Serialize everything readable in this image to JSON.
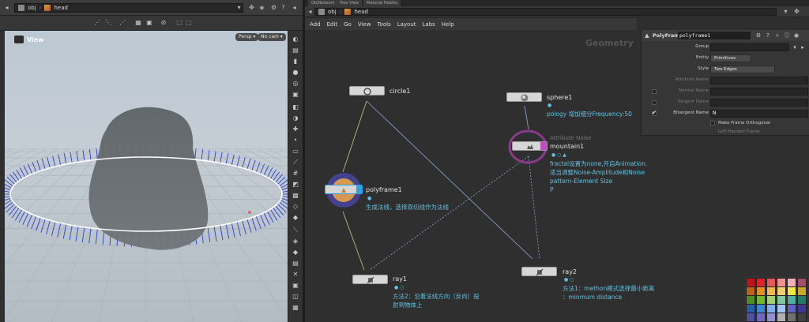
{
  "left": {
    "path": {
      "obj": "obj",
      "head": "head"
    },
    "viewport": {
      "view_label": "View",
      "persp_btn": "Persp ▾",
      "cam_btn": "No cam ▾"
    }
  },
  "right": {
    "tabs": [
      "ObjNetwork",
      "Tree View",
      "Material Palette"
    ],
    "path": {
      "obj": "obj",
      "head": "head"
    },
    "menus": [
      "Add",
      "Edit",
      "Go",
      "View",
      "Tools",
      "Layout",
      "Labs",
      "Help"
    ],
    "context_label": "Geometry",
    "nodes": {
      "circle1": {
        "name": "circle1"
      },
      "sphere1": {
        "name": "sphere1",
        "note": "pology 增加细分Frequency:50"
      },
      "mountain1": {
        "name": "mountain1",
        "sub": "Attribute Noise",
        "note_lines": [
          "fractal设置为none,开启Animation.",
          "适当调整Noise-Amplitude和Noise",
          "pattern-Element Size",
          "P"
        ]
      },
      "polyframe1": {
        "name": "polyframe1",
        "note": "生成法线，选择双切线作为法线"
      },
      "ray1": {
        "name": "ray1",
        "note_lines": [
          "方法2：沿着法线方向（反向）投",
          "射到物体上"
        ]
      },
      "ray2": {
        "name": "ray2",
        "note_lines": [
          "方法1：methon模式选择最小距离",
          "：minmum distance"
        ]
      }
    },
    "params": {
      "node_type": "PolyFrame",
      "node_name": "polyframe1",
      "group_label": "Group",
      "entity_label": "Entity",
      "entity_value": "Primitives",
      "style_label": "Style",
      "style_value": "Two Edges",
      "attr_name_label": "Attribute Name",
      "normal_name_label": "Normal Name",
      "tangent_name_label": "Tangent Name",
      "bitangent_name_label": "Bitangent Name",
      "bitangent_name_value": "N",
      "make_ortho_label": "Make Frame Orthogonal",
      "left_handed_label": "Left-Handed Frame"
    },
    "palette": [
      "#c0141c",
      "#e0202a",
      "#e85858",
      "#f09090",
      "#f4b0b8",
      "#a0506a",
      "#b86414",
      "#e09020",
      "#f0b850",
      "#f4d070",
      "#f4e840",
      "#c8a828",
      "#508c28",
      "#70b830",
      "#a0d070",
      "#80c8a0",
      "#50b0a0",
      "#287868",
      "#2860a8",
      "#3c88d8",
      "#80b0f0",
      "#a0c8f0",
      "#6060c8",
      "#403890",
      "#5050a0",
      "#7068c0",
      "#9090d0",
      "#b0b0b0",
      "#707070",
      "#404040"
    ]
  }
}
